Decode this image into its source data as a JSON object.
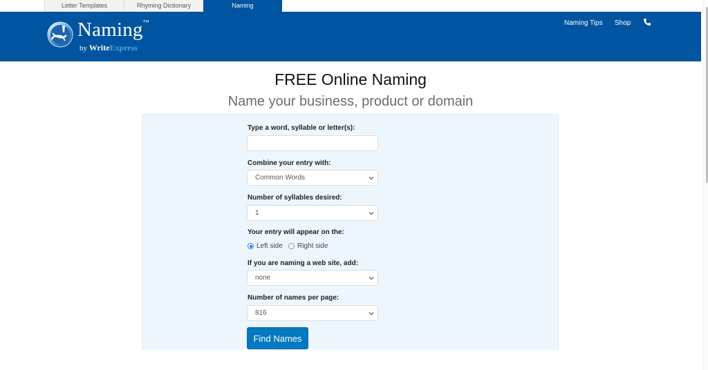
{
  "top_tabs": [
    {
      "label": "Letter Templates",
      "active": false
    },
    {
      "label": "Rhyming Dictionary",
      "active": false
    },
    {
      "label": "Naming",
      "active": true
    }
  ],
  "header": {
    "logo": {
      "title": "Naming",
      "tm": "™",
      "by": "by",
      "write": "Write",
      "express": "Express",
      "reg": "®"
    },
    "nav": {
      "tips": "Naming Tips",
      "shop": "Shop",
      "phone_icon": "phone-icon"
    },
    "colors": {
      "brand": "#0054a0",
      "button": "#0079c1",
      "panel": "#eef6fd"
    }
  },
  "page": {
    "title": "FREE Online Naming",
    "subtitle": "Name your business, product or domain"
  },
  "form": {
    "word": {
      "label": "Type a word, syllable or letter(s):",
      "value": "",
      "placeholder": ""
    },
    "combine": {
      "label": "Combine your entry with:",
      "selected": "Common Words"
    },
    "syllables": {
      "label": "Number of syllables desired:",
      "selected": "1"
    },
    "position": {
      "label": "Your entry will appear on the:",
      "options": [
        {
          "label": "Left side",
          "checked": true
        },
        {
          "label": "Right side",
          "checked": false
        }
      ]
    },
    "domain": {
      "label": "If you are naming a web site, add:",
      "selected": "none"
    },
    "per_page": {
      "label": "Number of names per page:",
      "selected": "816"
    },
    "submit_label": "Find Names"
  }
}
